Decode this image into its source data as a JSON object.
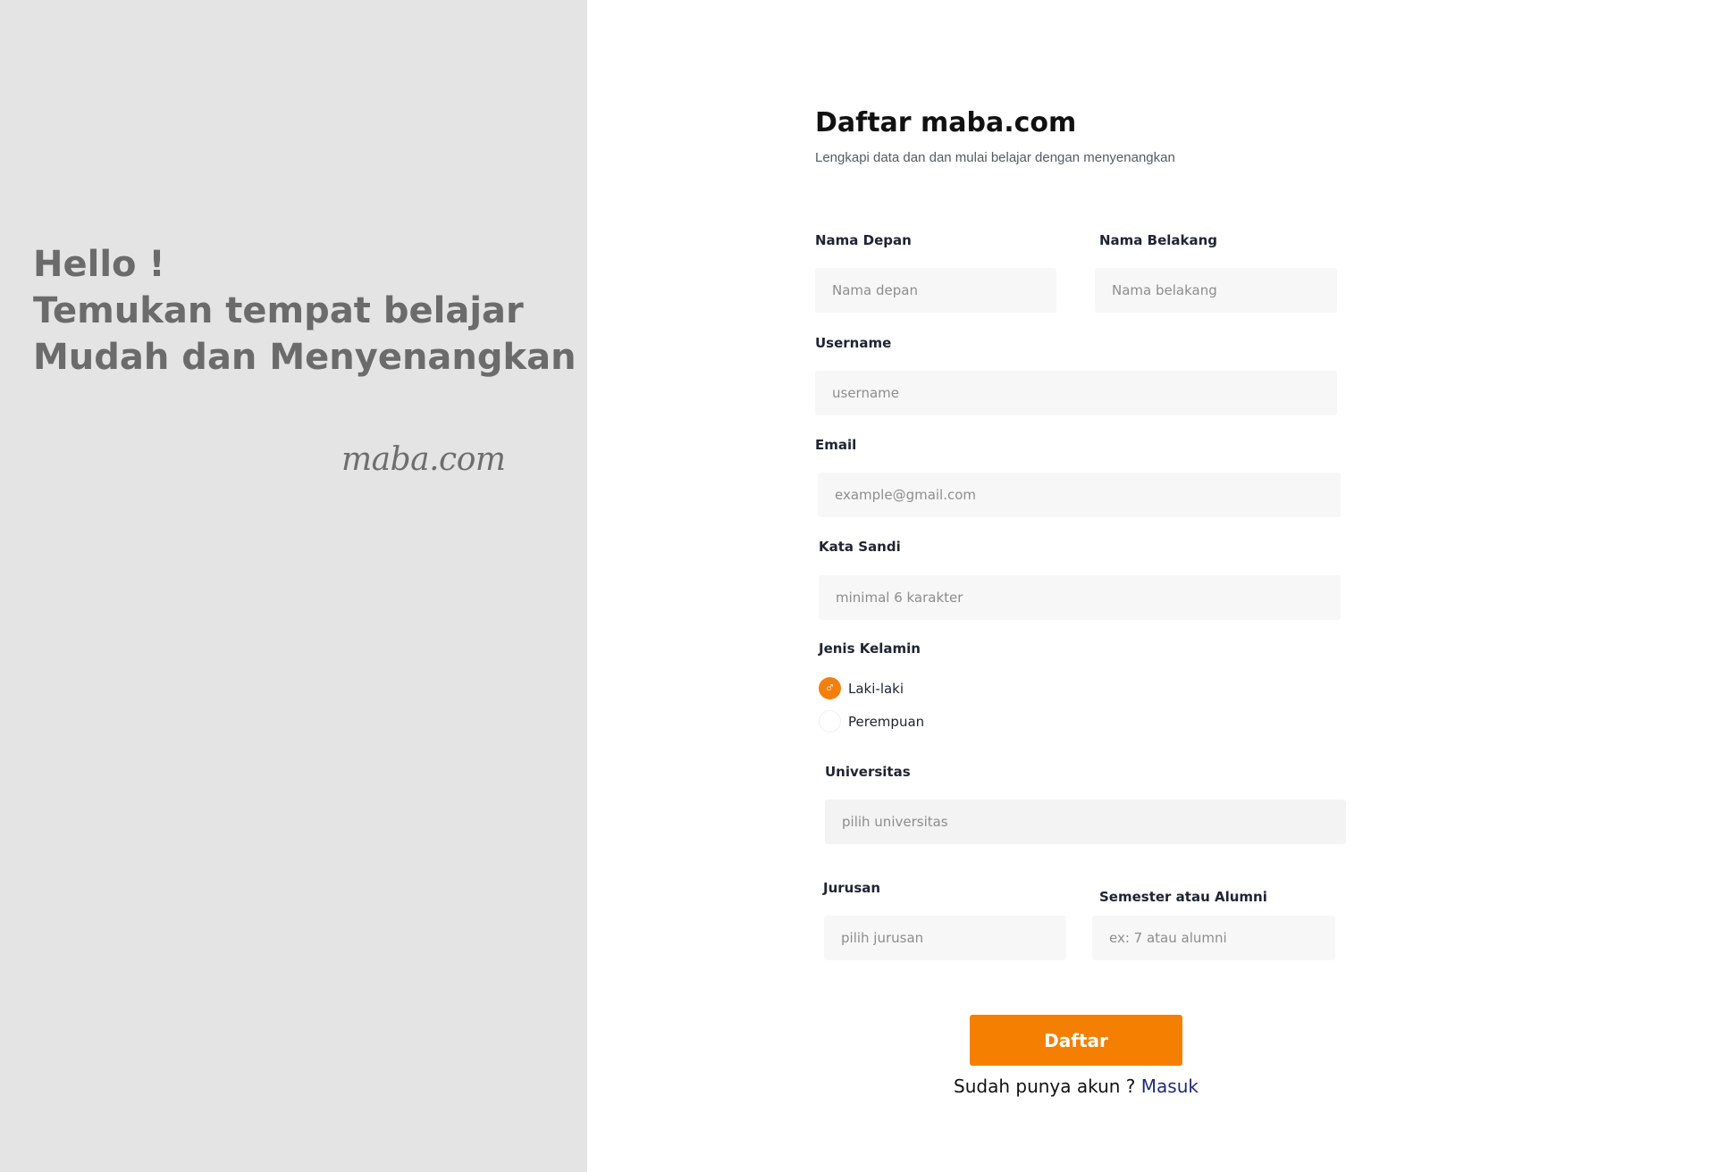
{
  "hero": {
    "line1": "Hello !",
    "line2": "Temukan tempat belajar",
    "line3": "Mudah dan Menyenangkan",
    "brand": "maba.com"
  },
  "form": {
    "title": "Daftar maba.com",
    "subtitle": "Lengkapi data dan dan mulai belajar dengan menyenangkan",
    "first_name": {
      "label": "Nama Depan",
      "placeholder": "Nama depan"
    },
    "last_name": {
      "label": "Nama Belakang",
      "placeholder": "Nama belakang"
    },
    "username": {
      "label": "Username",
      "placeholder": "username"
    },
    "email": {
      "label": "Email",
      "placeholder": "example@gmail.com"
    },
    "password": {
      "label": "Kata Sandi",
      "placeholder": "minimal 6 karakter"
    },
    "gender": {
      "label": "Jenis Kelamin",
      "male_label": "Laki-laki",
      "female_label": "Perempuan",
      "selected": "Laki-laki",
      "male_icon": "male-icon"
    },
    "university": {
      "label": "Universitas",
      "placeholder": "pilih universitas"
    },
    "major": {
      "label": "Jurusan",
      "placeholder": "pilih jurusan"
    },
    "semester": {
      "label": "Semester atau Alumni",
      "placeholder": "ex: 7 atau alumni"
    },
    "submit_label": "Daftar",
    "login_prompt": "Sudah punya akun ?",
    "login_link": "Masuk"
  },
  "colors": {
    "accent": "#f57f00",
    "left_panel": "#e4e4e4",
    "input_bg": "#f8f7f7",
    "link": "#1f2a7a"
  }
}
